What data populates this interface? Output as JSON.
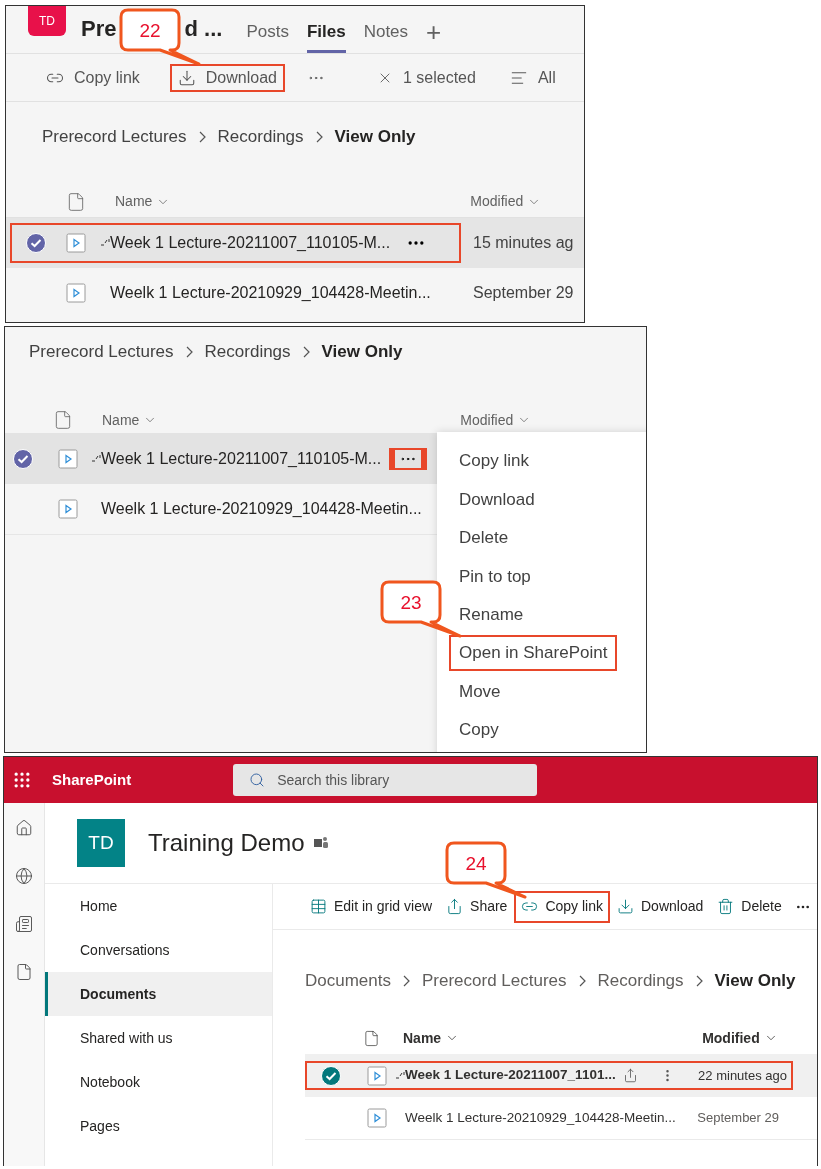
{
  "teams_files": {
    "avatar": "TD",
    "title_parts": [
      "Pre",
      "d ..."
    ],
    "tabs": [
      {
        "label": "Posts",
        "selected": false
      },
      {
        "label": "Files",
        "selected": true
      },
      {
        "label": "Notes",
        "selected": false
      }
    ],
    "add_tab": "+",
    "toolbar": [
      {
        "kind": "link",
        "label": "Copy link",
        "highlighted": false
      },
      {
        "kind": "download",
        "label": "Download",
        "highlighted": true
      },
      {
        "kind": "more",
        "highlighted": false
      }
    ],
    "selection": "1 selected",
    "view": "All",
    "breadcrumb": [
      "Prerecord Lectures",
      "Recordings",
      "View Only"
    ],
    "columns": [
      "Name",
      "Modified"
    ],
    "rows": [
      {
        "name": "Week 1 Lecture-20211007_110105-M...",
        "modified": "15 minutes ag",
        "selected": true,
        "is_new": true,
        "highlighted": true
      },
      {
        "name": "Weelk 1 Lecture-20210929_104428-Meetin...",
        "modified": "September 29",
        "selected": false,
        "is_new": false,
        "highlighted": false
      }
    ],
    "callout": "22"
  },
  "teams_menu": {
    "breadcrumb": [
      "Prerecord Lectures",
      "Recordings",
      "View Only"
    ],
    "columns": [
      "Name",
      "Modified"
    ],
    "rows": [
      {
        "name": "Week 1 Lecture-20211007_110105-M...",
        "selected": true,
        "is_new": true,
        "more_highlighted": true
      },
      {
        "name": "Weelk 1 Lecture-20210929_104428-Meetin...",
        "selected": false,
        "is_new": false
      }
    ],
    "menu": [
      {
        "label": "Copy link",
        "highlighted": false
      },
      {
        "label": "Download",
        "highlighted": false
      },
      {
        "label": "Delete",
        "highlighted": false
      },
      {
        "label": "Pin to top",
        "highlighted": false
      },
      {
        "label": "Rename",
        "highlighted": false
      },
      {
        "label": "Open in SharePoint",
        "highlighted": true
      },
      {
        "label": "Move",
        "highlighted": false
      },
      {
        "label": "Copy",
        "highlighted": false
      }
    ],
    "callout": "23"
  },
  "sharepoint": {
    "app_name": "SharePoint",
    "search": {
      "placeholder": "Search this library"
    },
    "site": {
      "avatar": "TD",
      "title": "Training Demo"
    },
    "nav": [
      {
        "label": "Home",
        "selected": false
      },
      {
        "label": "Conversations",
        "selected": false
      },
      {
        "label": "Documents",
        "selected": true
      },
      {
        "label": "Shared with us",
        "selected": false
      },
      {
        "label": "Notebook",
        "selected": false
      },
      {
        "label": "Pages",
        "selected": false
      }
    ],
    "commands": [
      {
        "kind": "grid",
        "label": "Edit in grid view",
        "highlighted": false
      },
      {
        "kind": "share",
        "label": "Share",
        "highlighted": false
      },
      {
        "kind": "link",
        "label": "Copy link",
        "highlighted": true
      },
      {
        "kind": "download",
        "label": "Download",
        "highlighted": false
      },
      {
        "kind": "delete",
        "label": "Delete",
        "highlighted": false
      },
      {
        "kind": "more",
        "highlighted": false
      }
    ],
    "breadcrumb": [
      "Documents",
      "Prerecord Lectures",
      "Recordings",
      "View Only"
    ],
    "columns": [
      "Name",
      "Modified"
    ],
    "rows": [
      {
        "name": "Week 1 Lecture-20211007_1101...",
        "modified": "22 minutes ago",
        "selected": true,
        "is_new": true,
        "highlighted": true
      },
      {
        "name": "Weelk 1 Lecture-20210929_104428-Meetin...",
        "modified": "September 29",
        "selected": false,
        "is_new": false,
        "highlighted": false
      }
    ],
    "callout": "24"
  }
}
